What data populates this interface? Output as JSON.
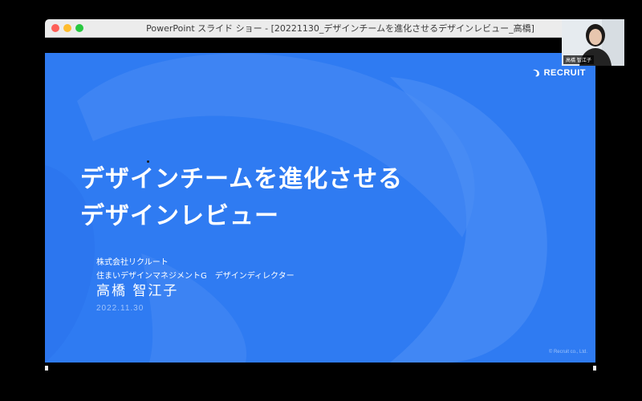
{
  "window": {
    "title": "PowerPoint スライド ショー - [20221130_デザインチームを進化させるデザインレビュー_高橋]"
  },
  "slide": {
    "logo": "RECRUIT",
    "title_line1": "デザインチームを進化させる",
    "title_line2": "デザインレビュー",
    "company": "株式会社リクルート",
    "role": "住まいデザインマネジメントG　デザインディレクター",
    "presenter": "高橋 智江子",
    "date": "2022.11.30",
    "copyright": "© Recruit co., Ltd.",
    "colors": {
      "background": "#2f7bf2",
      "shape_light": "#5a97f5"
    }
  },
  "webcam": {
    "name": "高橋 智江子"
  }
}
